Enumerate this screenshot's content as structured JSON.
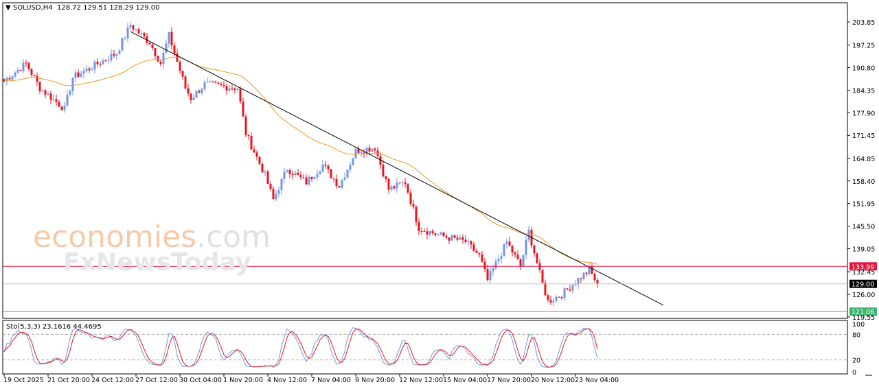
{
  "header": {
    "symbol": "SOLUSD,H4",
    "ohlc": "128.72 129.51 128.29 129.00"
  },
  "watermark": {
    "brand1": "economies",
    "brand1_suffix": ".com",
    "brand2": "FxNewsToday"
  },
  "colors": {
    "up": "#6f96e8",
    "down": "#e8141e",
    "ma": "#f0961e",
    "resistance": "#e8143c",
    "support": "#3cb371",
    "current": "#000000"
  },
  "chart_data": {
    "type": "candlestick",
    "title": "SOLUSD,H4",
    "price_ticks": [
      "203.85",
      "197.25",
      "190.80",
      "184.35",
      "177.90",
      "171.45",
      "164.85",
      "158.40",
      "151.95",
      "145.50",
      "139.05",
      "132.45",
      "126.00",
      "119.55"
    ],
    "ylim": [
      118.5,
      207.5
    ],
    "time_labels": [
      "19 Oct 2025",
      "21 Oct 20:00",
      "24 Oct 12:00",
      "27 Oct 12:00",
      "30 Oct 04:00",
      "1 Nov 20:00",
      "4 Nov 12:00",
      "7 Nov 04:00",
      "9 Nov 20:00",
      "12 Nov 12:00",
      "15 Nov 04:00",
      "17 Nov 20:00",
      "20 Nov 12:00",
      "23 Nov 04:00"
    ],
    "time_label_candle_index": [
      0,
      16,
      32,
      48,
      64,
      80,
      96,
      112,
      128,
      144,
      160,
      176,
      192,
      208
    ],
    "close_path": [
      [
        0,
        187
      ],
      [
        8,
        192
      ],
      [
        13,
        185
      ],
      [
        22,
        179
      ],
      [
        25,
        188
      ],
      [
        32,
        191
      ],
      [
        41,
        195
      ],
      [
        46,
        203
      ],
      [
        53,
        198
      ],
      [
        57,
        192
      ],
      [
        60,
        200
      ],
      [
        66,
        185
      ],
      [
        68,
        182
      ],
      [
        73,
        186
      ],
      [
        85,
        185
      ],
      [
        88,
        172
      ],
      [
        95,
        160
      ],
      [
        98,
        153
      ],
      [
        103,
        162
      ],
      [
        110,
        158
      ],
      [
        116,
        163
      ],
      [
        122,
        157
      ],
      [
        128,
        167
      ],
      [
        135,
        168
      ],
      [
        140,
        156
      ],
      [
        146,
        158
      ],
      [
        151,
        145
      ],
      [
        158,
        143
      ],
      [
        168,
        141
      ],
      [
        173,
        137
      ],
      [
        176,
        130
      ],
      [
        183,
        141
      ],
      [
        188,
        134
      ],
      [
        191,
        144
      ],
      [
        196,
        129
      ],
      [
        198,
        124
      ],
      [
        203,
        126
      ],
      [
        210,
        131
      ],
      [
        213,
        133
      ],
      [
        216,
        129
      ]
    ],
    "levels": [
      {
        "label": "133.99",
        "value": 133.99,
        "kind": "resistance"
      },
      {
        "label": "129.00",
        "value": 129.0,
        "kind": "current"
      },
      {
        "label": "121.06",
        "value": 121.06,
        "kind": "support"
      }
    ],
    "trendline": {
      "from": [
        46,
        201.1
      ],
      "to": [
        240,
        122.9
      ]
    },
    "moving_average_period": 50,
    "stochastic": {
      "label": "Sto(5,3,3) 23.1616 44.4695",
      "k": 23.1616,
      "d": 44.4695,
      "levels": [
        "100",
        "80",
        "20",
        "0"
      ]
    }
  }
}
